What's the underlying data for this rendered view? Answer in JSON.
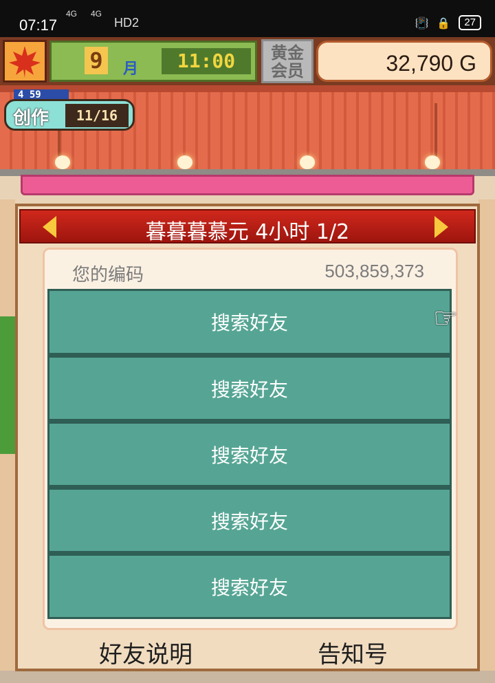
{
  "status_bar": {
    "time": "07:17",
    "signal1": "4G",
    "signal2": "4G",
    "hd_label": "HD2",
    "battery": "27"
  },
  "hud": {
    "month_number": "9",
    "month_unit": "月",
    "clock": "11:00",
    "vip_label_line1": "黄金",
    "vip_label_line2": "会员",
    "money": "32,790 G"
  },
  "creation_badge": {
    "timer": "4 59",
    "label": "创作",
    "progress": "11/16"
  },
  "dialog": {
    "title": "暮暮暮慕元  4小时 1/2",
    "code_label": "您的编码",
    "code_value": "503,859,373",
    "buttons": [
      {
        "label": "搜索好友"
      },
      {
        "label": "搜索好友"
      },
      {
        "label": "搜索好友"
      },
      {
        "label": "搜索好友"
      },
      {
        "label": "搜索好友"
      }
    ],
    "footer_left": "好友说明",
    "footer_right": "告知号"
  },
  "colors": {
    "accent_red": "#b3170f",
    "button_teal": "#56a594",
    "arrow_yellow": "#f8c93c"
  }
}
